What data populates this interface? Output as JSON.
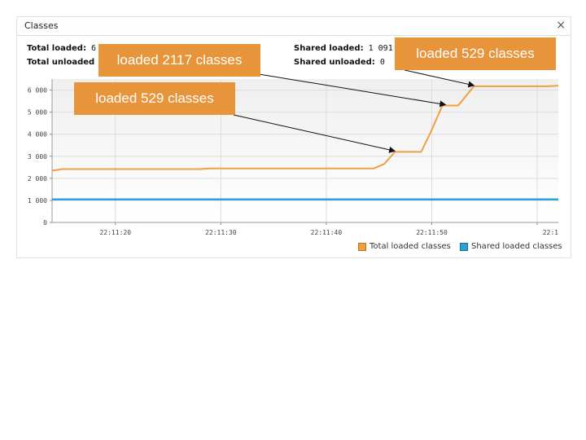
{
  "window": {
    "title": "Classes",
    "close_symbol": "×"
  },
  "stats": {
    "total_loaded_label": "Total loaded:",
    "total_loaded_value": "6",
    "total_unloaded_label": "Total unloaded",
    "shared_loaded_label": "Shared loaded:",
    "shared_loaded_value": "1 091",
    "shared_unloaded_label": "Shared unloaded:",
    "shared_unloaded_value": "0"
  },
  "legend": {
    "total": "Total loaded classes",
    "shared": "Shared loaded classes"
  },
  "callouts": {
    "a": "loaded 2117 classes",
    "b": "loaded 529 classes",
    "c": "loaded 529 classes"
  },
  "colors": {
    "total_line": "#f0a040",
    "shared_line": "#2ea0d8",
    "callout_bg": "#e8943a"
  },
  "chart_data": {
    "type": "line",
    "x_ticks": [
      "22:11:20",
      "22:11:30",
      "22:11:40",
      "22:11:50",
      "22:1"
    ],
    "y_ticks": [
      "0",
      "1 000",
      "2 000",
      "3 000",
      "4 000",
      "5 000",
      "6 000"
    ],
    "ylim": [
      0,
      6500
    ],
    "xlim": [
      0,
      48
    ],
    "grid": true,
    "series": [
      {
        "name": "Total loaded classes",
        "x": [
          0,
          1,
          14,
          15,
          24,
          30.5,
          31.5,
          32.5,
          35,
          36,
          37,
          38.5,
          40,
          41,
          47,
          48
        ],
        "y": [
          2350,
          2420,
          2420,
          2450,
          2450,
          2450,
          2650,
          3200,
          3200,
          4200,
          5300,
          5300,
          6170,
          6170,
          6170,
          6200
        ]
      },
      {
        "name": "Shared loaded classes",
        "x": [
          0,
          48
        ],
        "y": [
          1040,
          1040
        ]
      }
    ],
    "annotations": [
      {
        "text": "loaded 2117 classes",
        "x": 37.3,
        "y": 5300
      },
      {
        "text": "loaded 529 classes",
        "x": 32.5,
        "y": 3200
      },
      {
        "text": "loaded 529 classes",
        "x": 40,
        "y": 6170
      }
    ]
  }
}
